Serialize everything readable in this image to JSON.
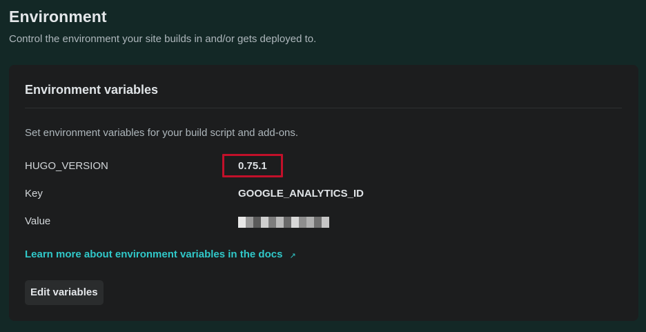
{
  "header": {
    "title": "Environment",
    "subtitle": "Control the environment your site builds in and/or gets deployed to."
  },
  "env_card": {
    "title": "Environment variables",
    "description": "Set environment variables for your build script and add-ons.",
    "variables": [
      {
        "label": "HUGO_VERSION",
        "value": "0.75.1",
        "highlighted": true
      },
      {
        "label": "Key",
        "value": "GOOGLE_ANALYTICS_ID",
        "highlighted": false
      },
      {
        "label": "Value",
        "value": "",
        "redacted": true
      }
    ],
    "docs_link": "Learn more about environment variables in the docs",
    "docs_link_icon": "external-link-arrow-icon",
    "edit_button": "Edit variables"
  },
  "colors": {
    "page_bg": "#132826",
    "card_bg": "#1c1d1e",
    "link": "#30c8c9",
    "highlight_border": "#c2102a",
    "button_bg": "#2a2c2d"
  }
}
